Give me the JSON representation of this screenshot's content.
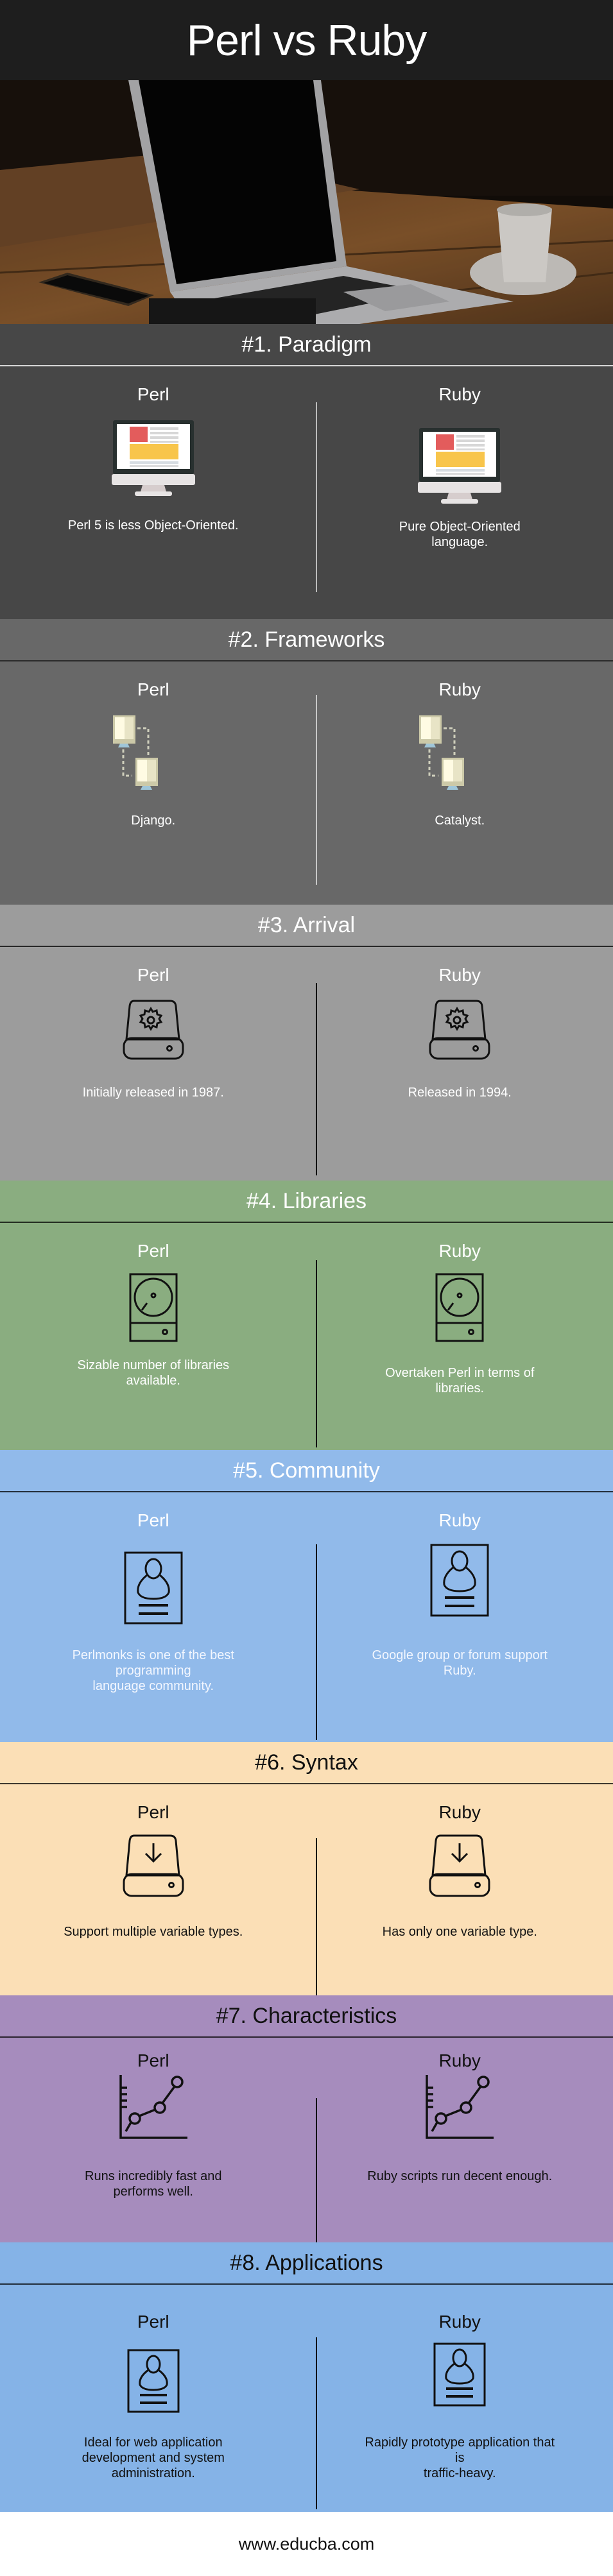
{
  "header": {
    "title": "Perl vs Ruby"
  },
  "hero": {
    "image_alt": "laptop-on-wooden-table"
  },
  "columns": {
    "left": "Perl",
    "right": "Ruby"
  },
  "sections": [
    {
      "title": "#1. Paradigm",
      "icon": "desktop-monitor-icon",
      "perl": "Perl 5 is less Object-Oriented.",
      "ruby": "Pure Object-Oriented\nlanguage.",
      "background": "#474747"
    },
    {
      "title": "#2. Frameworks",
      "icon": "network-computers-icon",
      "perl": "Django.",
      "ruby": "Catalyst.",
      "background": "#686868"
    },
    {
      "title": "#3. Arrival",
      "icon": "drive-gear-icon",
      "perl": "Initially released in 1987.",
      "ruby": "Released in 1994.",
      "background": "#9c9c9c"
    },
    {
      "title": "#4. Libraries",
      "icon": "hard-disk-icon",
      "perl": "Sizable number of libraries\navailable.",
      "ruby": "Overtaken Perl in terms of\nlibraries.",
      "background": "#8aad80"
    },
    {
      "title": "#5. Community",
      "icon": "user-profile-card-icon",
      "perl": "Perlmonks is one of the best\nprogramming\nlanguage community.",
      "ruby": "Google group or forum support\nRuby.",
      "background": "#91baea"
    },
    {
      "title": "#6. Syntax",
      "icon": "drive-download-icon",
      "perl": "Support multiple variable types.",
      "ruby": "Has only one variable type.",
      "background": "#fbdfb6"
    },
    {
      "title": "#7. Characteristics",
      "icon": "line-chart-icon",
      "perl": "Runs incredibly fast and\nperforms well.",
      "ruby": "Ruby scripts run decent enough.",
      "background": "#a68cbd"
    },
    {
      "title": "#8. Applications",
      "icon": "user-profile-card-icon",
      "perl": "Ideal for web application\ndevelopment and system\nadministration.",
      "ruby": "Rapidly prototype application that\nis\ntraffic-heavy.",
      "background": "#85b3e7"
    }
  ],
  "footer": {
    "url": "www.educba.com"
  }
}
